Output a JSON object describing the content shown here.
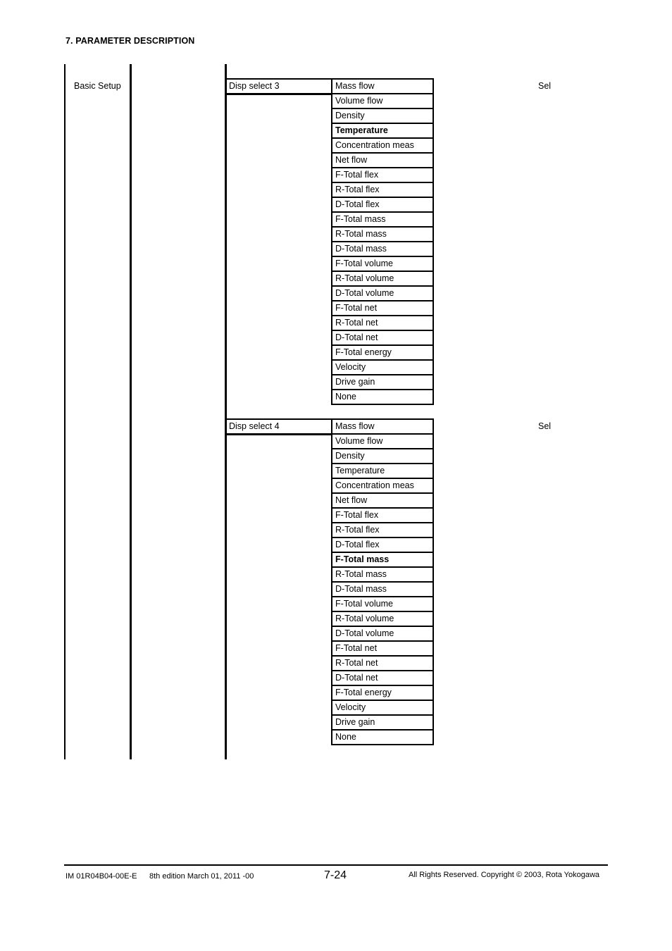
{
  "header": {
    "section_title": "7. PARAMETER DESCRIPTION"
  },
  "menu": {
    "label": "Basic Setup"
  },
  "params": [
    {
      "label": "Disp select 3",
      "access": "Sel",
      "options": [
        "Mass flow",
        "Volume flow",
        "Density",
        "Temperature",
        "Concentration meas",
        "Net flow",
        "F-Total flex",
        "R-Total flex",
        "D-Total flex",
        "F-Total mass",
        "R-Total mass",
        "D-Total mass",
        "F-Total volume",
        "R-Total volume",
        "D-Total volume",
        "F-Total net",
        "R-Total net",
        "D-Total net",
        "F-Total energy",
        "Velocity",
        "Drive gain",
        "None"
      ],
      "default_option": "Temperature"
    },
    {
      "label": "Disp select 4",
      "access": "Sel",
      "options": [
        "Mass flow",
        "Volume flow",
        "Density",
        "Temperature",
        "Concentration meas",
        "Net flow",
        "F-Total flex",
        "R-Total flex",
        "D-Total flex",
        "F-Total mass",
        "R-Total mass",
        "D-Total mass",
        "F-Total volume",
        "R-Total volume",
        "D-Total volume",
        "F-Total net",
        "R-Total net",
        "D-Total net",
        "F-Total energy",
        "Velocity",
        "Drive gain",
        "None"
      ],
      "default_option": "F-Total mass"
    }
  ],
  "footer": {
    "doc_id": "IM 01R04B04-00E-E",
    "edition": "8th edition March 01, 2011 -00",
    "page": "7-24",
    "copyright": "All Rights Reserved. Copyright © 2003, Rota Yokogawa"
  }
}
